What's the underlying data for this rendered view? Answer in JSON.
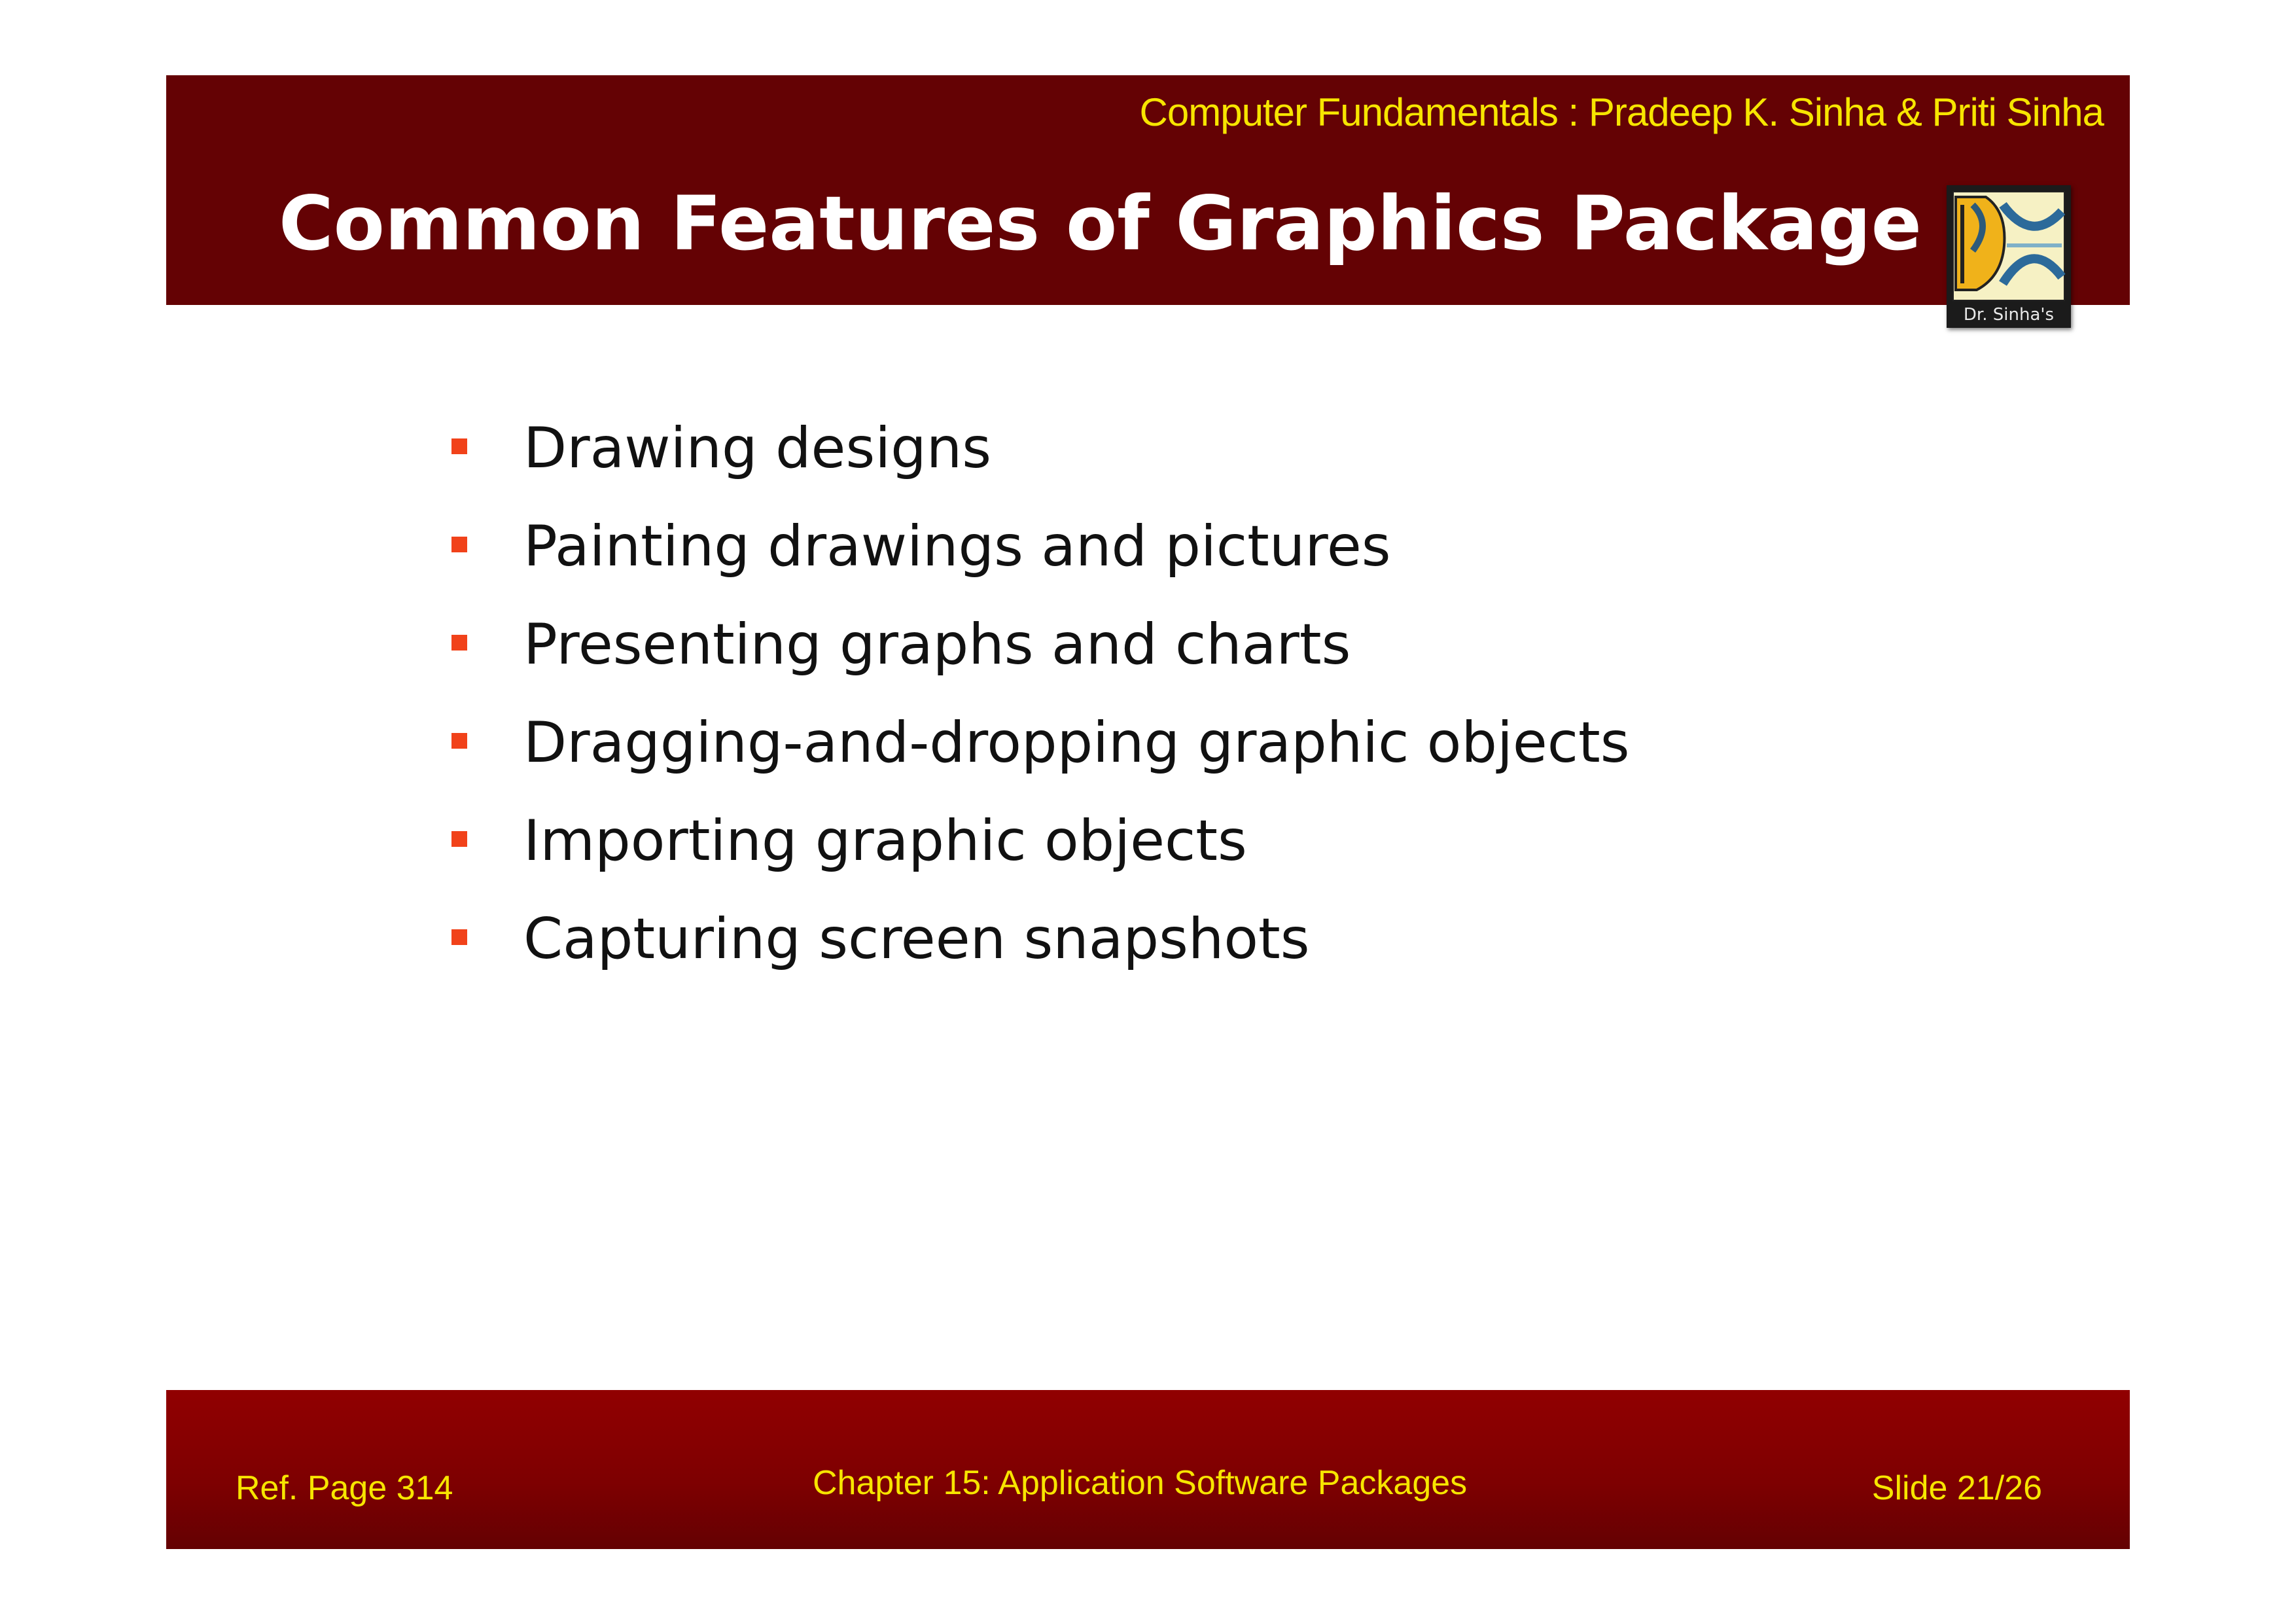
{
  "header": {
    "book_credit": "Computer Fundamentals : Pradeep K. Sinha & Priti Sinha",
    "title": "Common Features of Graphics Package",
    "logo_text": "Dr. Sinha's"
  },
  "bullets": [
    "Drawing designs",
    "Painting drawings and pictures",
    "Presenting graphs and charts",
    "Dragging-and-dropping graphic objects",
    "Importing graphic objects",
    "Capturing screen snapshots"
  ],
  "footer": {
    "ref_page": "Ref. Page  314",
    "chapter": "Chapter 15: Application Software Packages",
    "slide_number": "Slide 21/26"
  },
  "colors": {
    "header_bg": "#640204",
    "footer_bg": "#8b0001",
    "accent_text": "#f7e500",
    "bullet": "#f1421a"
  }
}
